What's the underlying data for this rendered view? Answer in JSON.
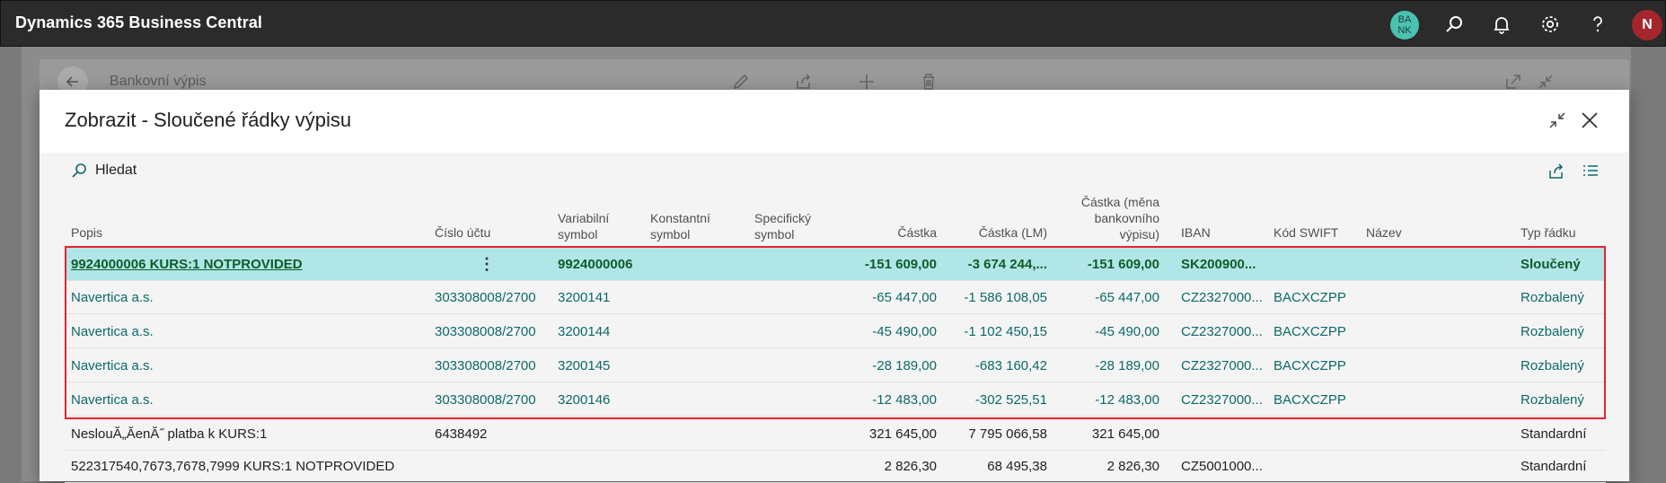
{
  "app": {
    "title": "Dynamics 365 Business Central",
    "company_badge": "BA\nNK",
    "user_initial": "N"
  },
  "background_page": {
    "title": "Bankovní výpis"
  },
  "dialog": {
    "title": "Zobrazit - Sloučené řádky výpisu",
    "search_label": "Hledat"
  },
  "columns": {
    "popis": "Popis",
    "cislo_uctu": "Číslo účtu",
    "variabilni": "Variabilní symbol",
    "konstantni": "Konstantní symbol",
    "specificky": "Specifický symbol",
    "castka": "Částka",
    "castka_lm": "Částka (LM)",
    "castka_mena": "Částka (měna bankovního výpisu)",
    "iban": "IBAN",
    "swift": "Kód SWIFT",
    "nazev": "Název",
    "typ": "Typ řádku"
  },
  "rows": [
    {
      "popis": "9924000006 KURS:1 NOTPROVIDED",
      "cislo": "",
      "vs": "9924000006",
      "ks": "",
      "ss": "",
      "castka": "-151 609,00",
      "castka_lm": "-3 674 244,...",
      "castka_mena": "-151 609,00",
      "iban": "SK200900...",
      "swift": "",
      "nazev": "",
      "typ": "Sloučený"
    },
    {
      "popis": "Navertica a.s.",
      "cislo": "303308008/2700",
      "vs": "3200141",
      "ks": "",
      "ss": "",
      "castka": "-65 447,00",
      "castka_lm": "-1 586 108,05",
      "castka_mena": "-65 447,00",
      "iban": "CZ2327000...",
      "swift": "BACXCZPP",
      "nazev": "",
      "typ": "Rozbalený"
    },
    {
      "popis": "Navertica a.s.",
      "cislo": "303308008/2700",
      "vs": "3200144",
      "ks": "",
      "ss": "",
      "castka": "-45 490,00",
      "castka_lm": "-1 102 450,15",
      "castka_mena": "-45 490,00",
      "iban": "CZ2327000...",
      "swift": "BACXCZPP",
      "nazev": "",
      "typ": "Rozbalený"
    },
    {
      "popis": "Navertica a.s.",
      "cislo": "303308008/2700",
      "vs": "3200145",
      "ks": "",
      "ss": "",
      "castka": "-28 189,00",
      "castka_lm": "-683 160,42",
      "castka_mena": "-28 189,00",
      "iban": "CZ2327000...",
      "swift": "BACXCZPP",
      "nazev": "",
      "typ": "Rozbalený"
    },
    {
      "popis": "Navertica a.s.",
      "cislo": "303308008/2700",
      "vs": "3200146",
      "ks": "",
      "ss": "",
      "castka": "-12 483,00",
      "castka_lm": "-302 525,51",
      "castka_mena": "-12 483,00",
      "iban": "CZ2327000...",
      "swift": "BACXCZPP",
      "nazev": "",
      "typ": "Rozbalený"
    },
    {
      "popis": "NeslouĂ„ĂenĂ˝ platba k KURS:1",
      "cislo": "6438492",
      "vs": "",
      "ks": "",
      "ss": "",
      "castka": "321 645,00",
      "castka_lm": "7 795 066,58",
      "castka_mena": "321 645,00",
      "iban": "",
      "swift": "",
      "nazev": "",
      "typ": "Standardní"
    },
    {
      "popis": "522317540,7673,7678,7999 KURS:1 NOTPROVIDED",
      "cislo": "",
      "vs": "",
      "ks": "",
      "ss": "",
      "castka": "2 826,30",
      "castka_lm": "68 495,38",
      "castka_mena": "2 826,30",
      "iban": "CZ5001000...",
      "swift": "",
      "nazev": "",
      "typ": "Standardní"
    }
  ]
}
